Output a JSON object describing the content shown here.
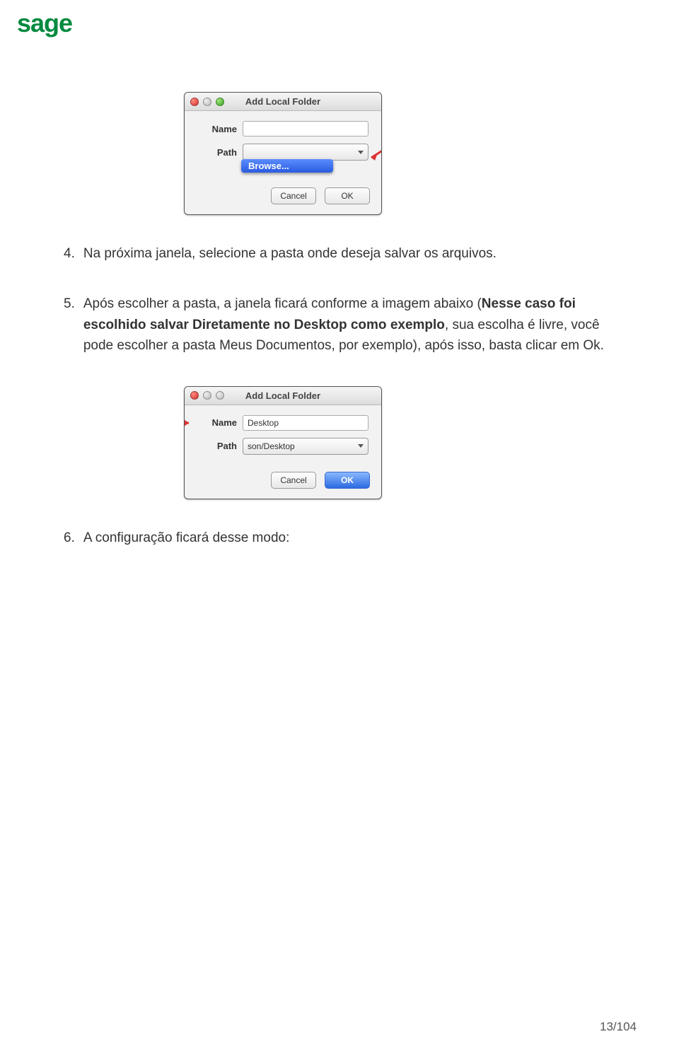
{
  "logo": "sage",
  "dialog1": {
    "title": "Add Local Folder",
    "name_label": "Name",
    "path_label": "Path",
    "browse_option": "Browse...",
    "cancel_label": "Cancel",
    "ok_label": "OK"
  },
  "step4": {
    "num": "4.",
    "text": "Na próxima janela, selecione a pasta onde deseja salvar os arquivos."
  },
  "step5": {
    "num": "5.",
    "text_a": "Após escolher a pasta, a janela ficará conforme a imagem abaixo (",
    "text_bold": "Nesse caso foi escolhido salvar Diretamente no Desktop como exemplo",
    "text_b": ", sua escolha é livre, você pode escolher a pasta Meus Documentos, por exemplo), após isso, basta clicar em Ok."
  },
  "dialog2": {
    "title": "Add Local Folder",
    "name_label": "Name",
    "name_value": "Desktop",
    "path_label": "Path",
    "path_value": "son/Desktop",
    "cancel_label": "Cancel",
    "ok_label": "OK"
  },
  "step6": {
    "num": "6.",
    "text": "A configuração ficará desse modo:"
  },
  "page_number": "13/104"
}
